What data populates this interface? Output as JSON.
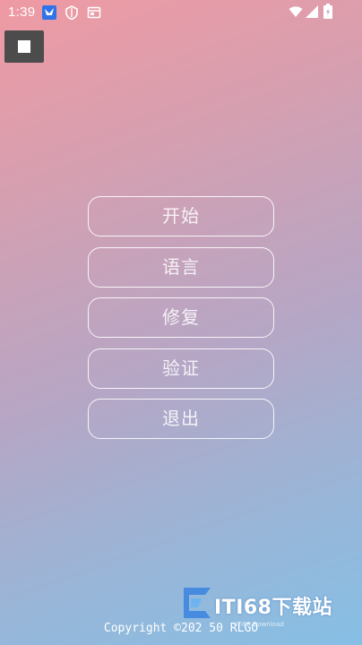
{
  "status_bar": {
    "time": "1:39",
    "icons": [
      "feishu-app-icon",
      "shield-app-icon",
      "notification-card-icon",
      "wifi-icon",
      "cellular-signal-icon",
      "battery-charging-icon"
    ]
  },
  "overlay": {
    "stop_icon": "stop-square-icon"
  },
  "menu": {
    "items": [
      {
        "label": "开始"
      },
      {
        "label": "语言"
      },
      {
        "label": "修复"
      },
      {
        "label": "验证"
      },
      {
        "label": "退出"
      }
    ]
  },
  "footer": {
    "copyright": "Copyright ©202  50 RLGO"
  },
  "watermark": {
    "brand": "ITI68下载站",
    "sub": "iTi68 Download"
  },
  "colors": {
    "gradient_top": "#ef9aa3",
    "gradient_bottom": "#86bfe4",
    "button_border": "#ffffff",
    "stop_button_bg": "#4c4c4c"
  }
}
